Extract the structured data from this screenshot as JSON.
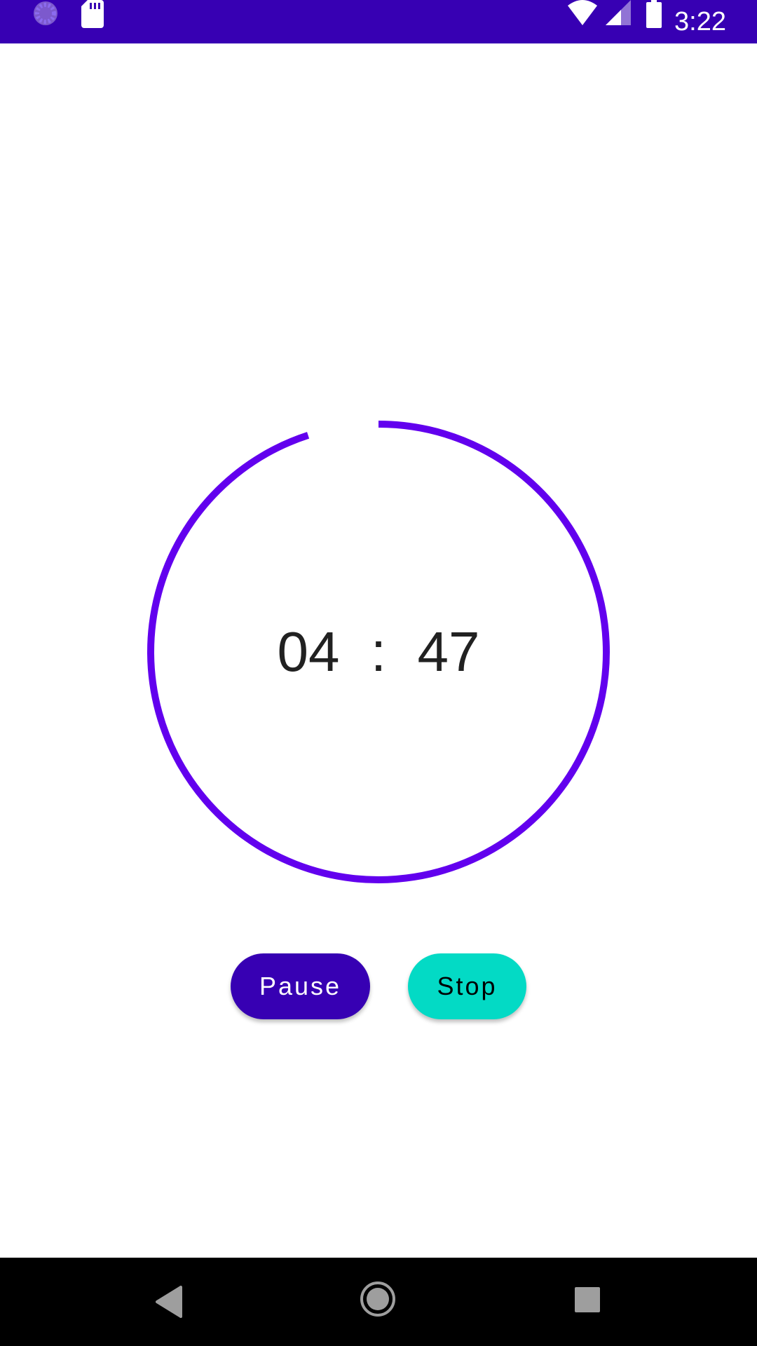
{
  "status_bar": {
    "time": "3:22",
    "background_color": "#3700b3",
    "icons": [
      "sync-icon",
      "sd-card-icon",
      "wifi-icon",
      "signal-icon",
      "battery-icon"
    ]
  },
  "timer": {
    "minutes": "04",
    "separator": ":",
    "seconds": "47",
    "ring_color": "#6200ee",
    "progress_fraction": 0.95
  },
  "buttons": {
    "pause_label": "Pause",
    "pause_color": "#3700b3",
    "stop_label": "Stop",
    "stop_color": "#03dac5"
  },
  "nav_bar": {
    "icons": [
      "back-icon",
      "home-icon",
      "recents-icon"
    ]
  }
}
